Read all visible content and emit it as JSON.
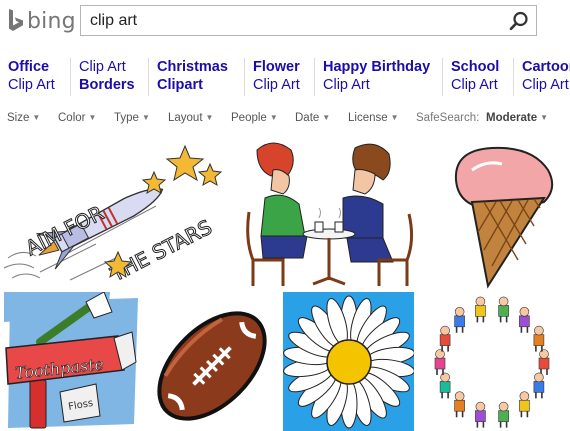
{
  "header": {
    "logo_text": "bing",
    "search_value": "clip art"
  },
  "related": [
    {
      "bold": "Office",
      "normal": "Clip Art"
    },
    {
      "normal": "Clip Art",
      "bold": "Borders"
    },
    {
      "bold": "Christmas",
      "bold2": "Clipart"
    },
    {
      "bold": "Flower",
      "normal": "Clip Art"
    },
    {
      "bold": "Happy Birthday",
      "normal": "Clip Art"
    },
    {
      "bold": "School",
      "normal": "Clip Art"
    },
    {
      "bold": "Cartoon",
      "normal": "Clip Art"
    }
  ],
  "filters": {
    "size": "Size",
    "color": "Color",
    "type": "Type",
    "layout": "Layout",
    "people": "People",
    "date": "Date",
    "license": "License",
    "safesearch_label": "SafeSearch:",
    "safesearch_value": "Moderate"
  },
  "results": {
    "aim_for_the_stars": {
      "line1": "AIM FOR",
      "line2": "THE STARS"
    },
    "toothpaste": {
      "tube_text": "Toothpaste",
      "floss_text": "Floss"
    }
  },
  "colors": {
    "link": "#1a0dab",
    "logo_gray": "#767676",
    "daisy_sky": "#2aa0e6",
    "ice_cream_pink": "#f2a6a8",
    "cone_brown": "#b2723a",
    "football_brown": "#8b3a1c"
  },
  "icons": {
    "logo": "bing-b-icon",
    "search": "magnifier-icon",
    "caret": "caret-down-icon"
  }
}
